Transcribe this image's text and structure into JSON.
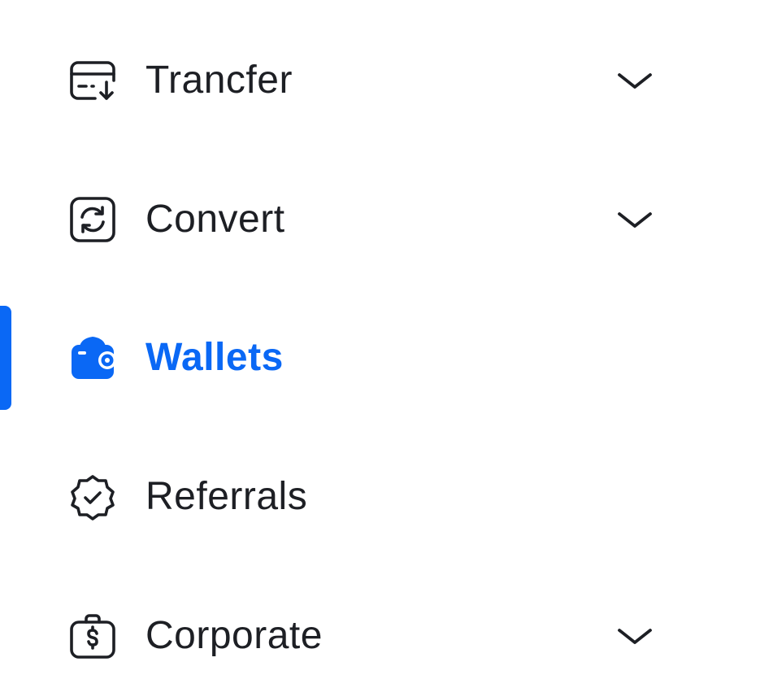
{
  "colors": {
    "text": "#1d1f24",
    "accent": "#0a68f5",
    "background": "#ffffff"
  },
  "nav": {
    "active_item": "wallets",
    "items": [
      {
        "id": "transfer",
        "label": "Trancfer",
        "icon": "transfer-card-icon",
        "expandable": true
      },
      {
        "id": "convert",
        "label": "Convert",
        "icon": "convert-arrows-icon",
        "expandable": true
      },
      {
        "id": "wallets",
        "label": "Wallets",
        "icon": "wallet-icon",
        "expandable": false
      },
      {
        "id": "referrals",
        "label": "Referrals",
        "icon": "verified-badge-icon",
        "expandable": false
      },
      {
        "id": "corporate",
        "label": "Corporate",
        "icon": "briefcase-dollar-icon",
        "expandable": true
      }
    ]
  }
}
